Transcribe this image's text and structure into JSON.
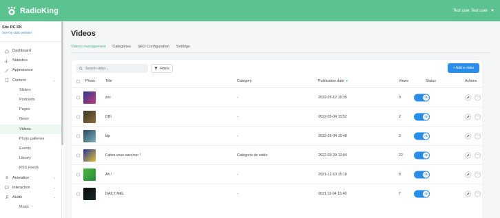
{
  "header": {
    "brand_name": "RadioKing",
    "user_menu_label": "Test user Test user",
    "brand_color": "#5cc28f"
  },
  "sidebar": {
    "site_name": "Site RC RK",
    "site_link": "See my radio website",
    "items": [
      {
        "label": "Dashboard",
        "icon": "home-icon"
      },
      {
        "label": "Statistics",
        "icon": "chart-icon"
      },
      {
        "label": "Appearance",
        "icon": "brush-icon"
      },
      {
        "label": "Content",
        "icon": "document-icon",
        "expanded": true
      },
      {
        "label": "Sliders",
        "sub": true
      },
      {
        "label": "Podcasts",
        "sub": true
      },
      {
        "label": "Pages",
        "sub": true
      },
      {
        "label": "News",
        "sub": true
      },
      {
        "label": "Videos",
        "sub": true,
        "active": true
      },
      {
        "label": "Photo galleries",
        "sub": true
      },
      {
        "label": "Events",
        "sub": true
      },
      {
        "label": "Library",
        "sub": true
      },
      {
        "label": "RSS Feeds",
        "sub": true
      },
      {
        "label": "Animation",
        "icon": "mic-icon"
      },
      {
        "label": "Interaction",
        "icon": "chat-icon"
      },
      {
        "label": "Audio",
        "icon": "music-icon"
      },
      {
        "label": "Music",
        "sub": true
      }
    ]
  },
  "main": {
    "title": "Videos",
    "tabs": [
      "Videos management",
      "Categories",
      "SEO Configuration",
      "Settings"
    ],
    "active_tab": 0
  },
  "toolbar": {
    "search_placeholder": "Search video...",
    "filters_label": "Filters",
    "add_label": "+ Add a video",
    "accent": "#2a8ee8"
  },
  "table": {
    "columns": [
      "Photo",
      "Title",
      "Category",
      "Publication date",
      "Views",
      "Status",
      "Actions"
    ],
    "rows": [
      {
        "title": "zzz",
        "category": "-",
        "date": "2022-05-12 15:35",
        "views": "0",
        "thumb": [
          "#2a3d8f",
          "#c43a7a"
        ]
      },
      {
        "title": "DBI",
        "category": "-",
        "date": "2022-05-04 15:52",
        "views": "2",
        "thumb": [
          "#3a3a2a",
          "#8c6c3a"
        ]
      },
      {
        "title": "ldp",
        "category": "-",
        "date": "2022-05-04 15:48",
        "views": "3",
        "thumb": [
          "#2a4a5a",
          "#7ab0c0"
        ]
      },
      {
        "title": "Faites vous vacciner !",
        "category": "Catégorie de vidéo",
        "date": "2022-03-29 12:04",
        "views": "22",
        "thumb": [
          "#2a3aa0",
          "#e0c030"
        ]
      },
      {
        "title": "Ah !",
        "category": "-",
        "date": "2021-12-10 15:10",
        "views": "8",
        "thumb": [
          "#4ab840",
          "#2a8a3a"
        ]
      },
      {
        "title": "DAILY MEL",
        "category": "-",
        "date": "2021-11-04 15:40",
        "views": "7",
        "thumb": [
          "#0a0a0a",
          "#1a2a2a"
        ]
      }
    ]
  }
}
